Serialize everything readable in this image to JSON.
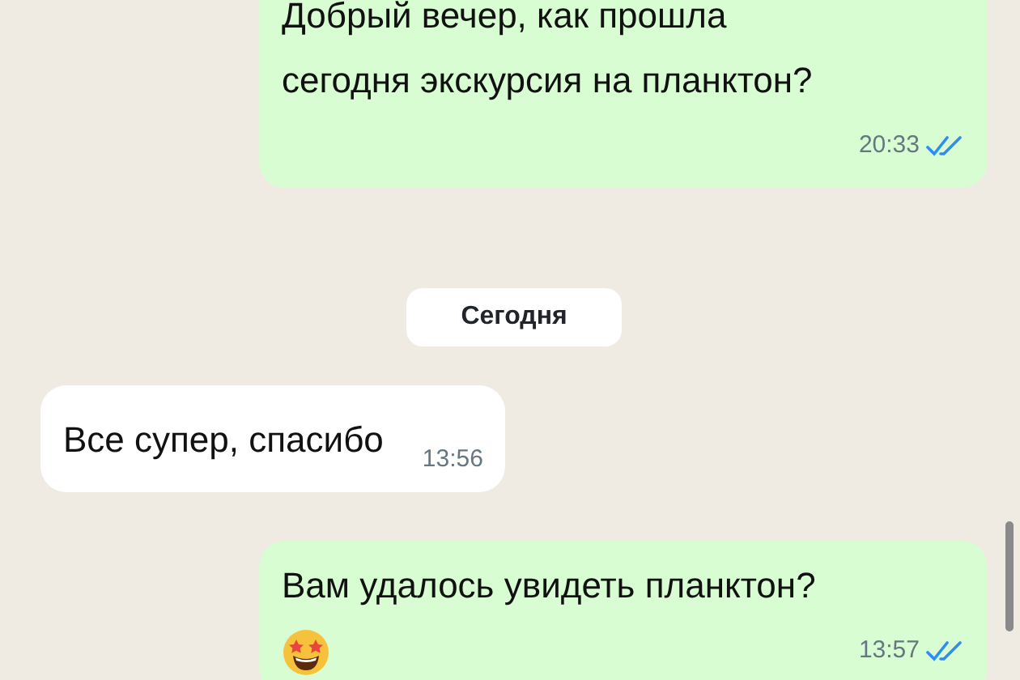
{
  "messages": [
    {
      "kind": "outgoing",
      "lines": [
        "Добрый вечер, как прошла",
        "сегодня экскурсия на планктон?"
      ],
      "time": "20:33",
      "read": true
    },
    {
      "kind": "date",
      "text": "Сегодня"
    },
    {
      "kind": "incoming",
      "lines": [
        "Все супер, спасибо"
      ],
      "time": "13:56"
    },
    {
      "kind": "outgoing",
      "lines": [
        "Вам удалось увидеть планктон?"
      ],
      "sticker": true,
      "time": "13:57",
      "read": true
    }
  ]
}
